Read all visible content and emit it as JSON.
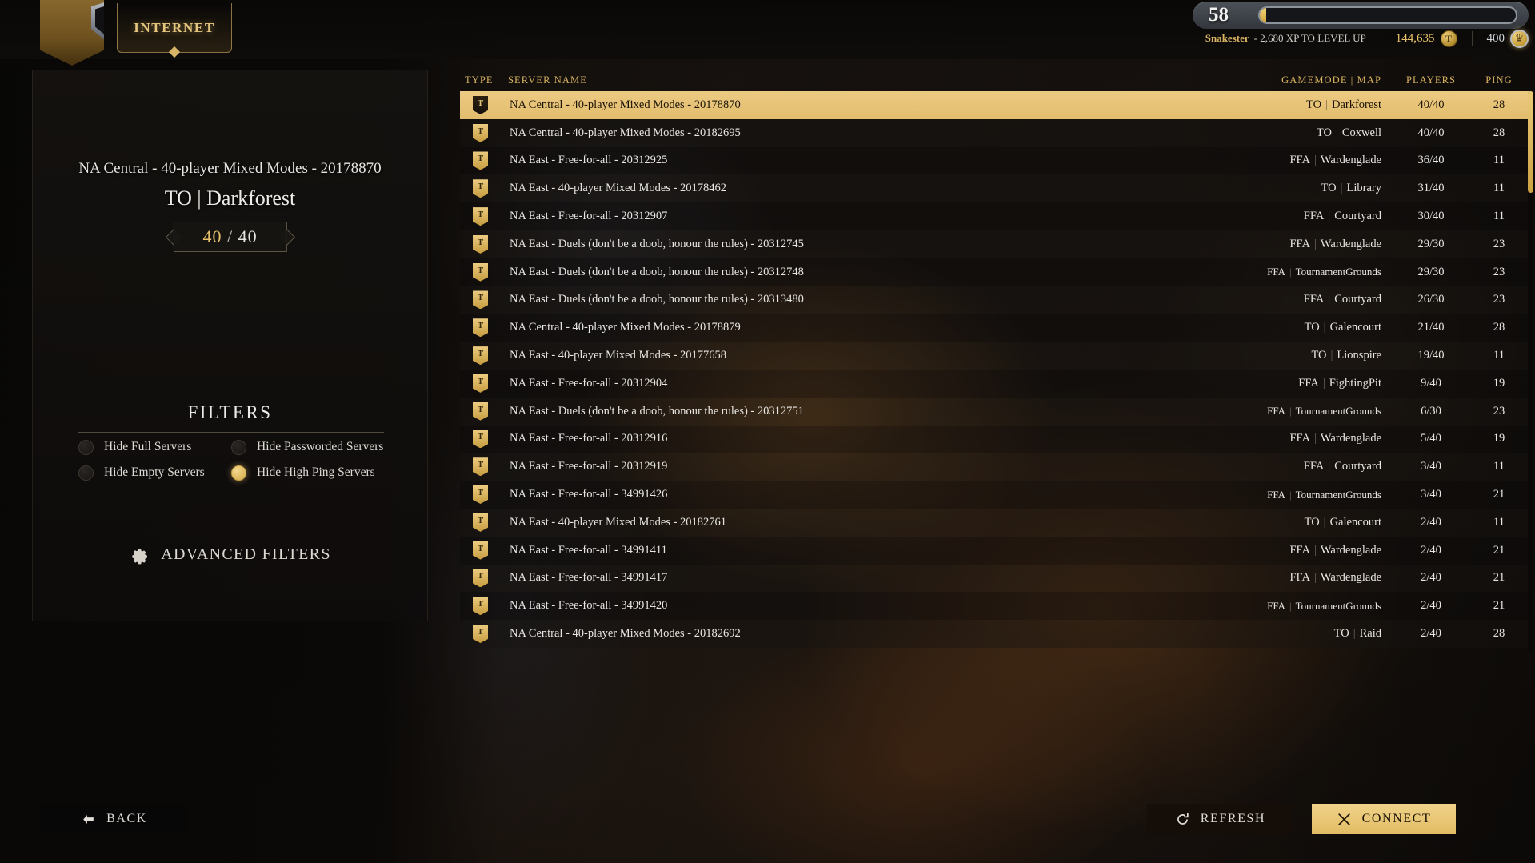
{
  "app": {
    "tab_label": "INTERNET",
    "logo_icon": "shield-banner-icon"
  },
  "hud": {
    "level": "58",
    "xp_percent": 2.6,
    "player_name": "Snakester",
    "xp_text": "- 2,680 XP TO LEVEL UP",
    "gold_value": "144,635",
    "gold_icon": "gold-coin-icon",
    "crowns_value": "400",
    "crowns_icon": "crown-coin-icon"
  },
  "selected_server": {
    "name": "NA Central - 40-player Mixed Modes - 20178870",
    "gamemode_map": "TO | Darkforest",
    "players_current": "40",
    "players_separator": "/",
    "players_max": "40"
  },
  "filters": {
    "title": "FILTERS",
    "items": [
      {
        "label": "Hide Full Servers",
        "enabled": false
      },
      {
        "label": "Hide Passworded Servers",
        "enabled": false
      },
      {
        "label": "Hide Empty Servers",
        "enabled": false
      },
      {
        "label": "Hide High Ping Servers",
        "enabled": true
      }
    ],
    "advanced_label": "ADVANCED FILTERS",
    "advanced_icon": "gear-icon"
  },
  "table": {
    "headers": {
      "type": "TYPE",
      "name": "SERVER NAME",
      "mode": "GAMEMODE | MAP",
      "players": "PLAYERS",
      "ping": "PING"
    },
    "rows": [
      {
        "type_icon": "banner-icon",
        "name": "NA Central - 40-player Mixed Modes - 20178870",
        "mode": "TO",
        "map": "Darkforest",
        "players": "40/40",
        "ping": "28",
        "selected": true
      },
      {
        "type_icon": "banner-icon",
        "name": "NA Central - 40-player Mixed Modes - 20182695",
        "mode": "TO",
        "map": "Coxwell",
        "players": "40/40",
        "ping": "28",
        "selected": false
      },
      {
        "type_icon": "banner-icon",
        "name": "NA East - Free-for-all - 20312925",
        "mode": "FFA",
        "map": "Wardenglade",
        "players": "36/40",
        "ping": "11",
        "selected": false
      },
      {
        "type_icon": "banner-icon",
        "name": "NA East - 40-player Mixed Modes - 20178462",
        "mode": "TO",
        "map": "Library",
        "players": "31/40",
        "ping": "11",
        "selected": false
      },
      {
        "type_icon": "banner-icon",
        "name": "NA East - Free-for-all - 20312907",
        "mode": "FFA",
        "map": "Courtyard",
        "players": "30/40",
        "ping": "11",
        "selected": false
      },
      {
        "type_icon": "banner-icon",
        "name": "NA East - Duels (don't be a doob, honour the rules) - 20312745",
        "mode": "FFA",
        "map": "Wardenglade",
        "players": "29/30",
        "ping": "23",
        "selected": false
      },
      {
        "type_icon": "banner-icon",
        "name": "NA East - Duels (don't be a doob, honour the rules) - 20312748",
        "mode": "FFA",
        "map": "TournamentGrounds",
        "players": "29/30",
        "ping": "23",
        "selected": false
      },
      {
        "type_icon": "banner-icon",
        "name": "NA East - Duels (don't be a doob, honour the rules) - 20313480",
        "mode": "FFA",
        "map": "Courtyard",
        "players": "26/30",
        "ping": "23",
        "selected": false
      },
      {
        "type_icon": "banner-icon",
        "name": "NA Central - 40-player Mixed Modes - 20178879",
        "mode": "TO",
        "map": "Galencourt",
        "players": "21/40",
        "ping": "28",
        "selected": false
      },
      {
        "type_icon": "banner-icon",
        "name": "NA East - 40-player Mixed Modes - 20177658",
        "mode": "TO",
        "map": "Lionspire",
        "players": "19/40",
        "ping": "11",
        "selected": false
      },
      {
        "type_icon": "banner-icon",
        "name": "NA East - Free-for-all - 20312904",
        "mode": "FFA",
        "map": "FightingPit",
        "players": "9/40",
        "ping": "19",
        "selected": false
      },
      {
        "type_icon": "banner-icon",
        "name": "NA East - Duels (don't be a doob, honour the rules) - 20312751",
        "mode": "FFA",
        "map": "TournamentGrounds",
        "players": "6/30",
        "ping": "23",
        "selected": false
      },
      {
        "type_icon": "banner-icon",
        "name": "NA East - Free-for-all - 20312916",
        "mode": "FFA",
        "map": "Wardenglade",
        "players": "5/40",
        "ping": "19",
        "selected": false
      },
      {
        "type_icon": "banner-icon",
        "name": "NA East - Free-for-all - 20312919",
        "mode": "FFA",
        "map": "Courtyard",
        "players": "3/40",
        "ping": "11",
        "selected": false
      },
      {
        "type_icon": "banner-icon",
        "name": "NA East - Free-for-all - 34991426",
        "mode": "FFA",
        "map": "TournamentGrounds",
        "players": "3/40",
        "ping": "21",
        "selected": false
      },
      {
        "type_icon": "banner-icon",
        "name": "NA East - 40-player Mixed Modes - 20182761",
        "mode": "TO",
        "map": "Galencourt",
        "players": "2/40",
        "ping": "11",
        "selected": false
      },
      {
        "type_icon": "banner-icon",
        "name": "NA East - Free-for-all - 34991411",
        "mode": "FFA",
        "map": "Wardenglade",
        "players": "2/40",
        "ping": "21",
        "selected": false
      },
      {
        "type_icon": "banner-icon",
        "name": "NA East - Free-for-all - 34991417",
        "mode": "FFA",
        "map": "Wardenglade",
        "players": "2/40",
        "ping": "21",
        "selected": false
      },
      {
        "type_icon": "banner-icon",
        "name": "NA East - Free-for-all - 34991420",
        "mode": "FFA",
        "map": "TournamentGrounds",
        "players": "2/40",
        "ping": "21",
        "selected": false
      },
      {
        "type_icon": "banner-icon",
        "name": "NA Central - 40-player Mixed Modes - 20182692",
        "mode": "TO",
        "map": "Raid",
        "players": "2/40",
        "ping": "28",
        "selected": false
      }
    ]
  },
  "actions": {
    "back_label": "BACK",
    "back_icon": "arrow-left-icon",
    "refresh_label": "REFRESH",
    "refresh_icon": "refresh-icon",
    "connect_label": "CONNECT",
    "connect_icon": "crossed-swords-icon"
  },
  "colors": {
    "accent_gold": "#d9b461",
    "selected_row": "#e7c277",
    "text_primary": "#e8e6e2"
  }
}
